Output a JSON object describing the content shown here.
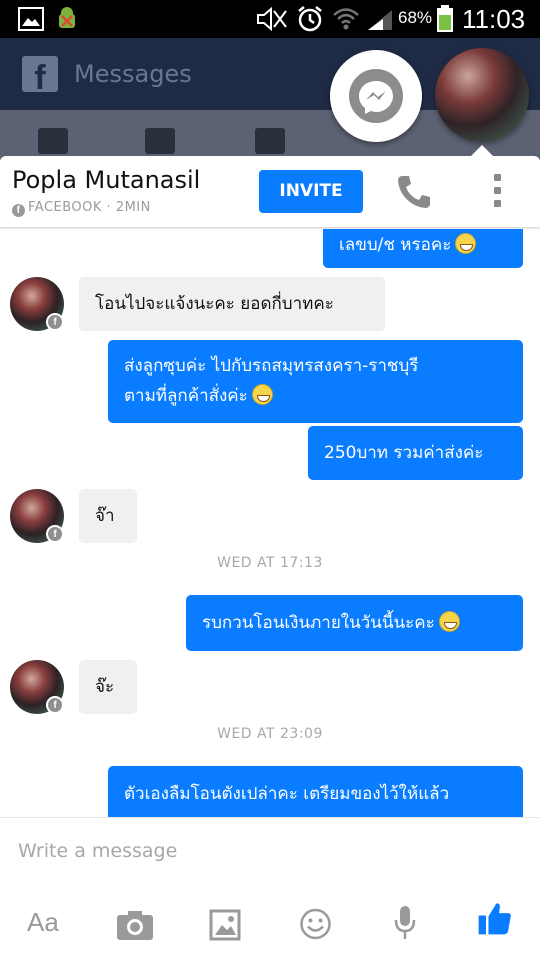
{
  "status_bar": {
    "battery_percent": "68%",
    "time": "11:03",
    "icons": [
      "gallery-icon",
      "android-debug-icon",
      "mute-icon",
      "alarm-icon",
      "wifi-icon",
      "signal-icon",
      "battery-icon"
    ]
  },
  "background_app": {
    "title": "Messages",
    "logo": "f"
  },
  "chat": {
    "contact_name": "Popla Mutanasil",
    "source": "FACEBOOK · 2MIN",
    "invite_label": "INVITE",
    "messages": [
      {
        "dir": "out",
        "text": "เลขบ/ช หรอคะ",
        "emoji": true
      },
      {
        "dir": "in",
        "text": "โอนไปจะแจ้งนะคะ ยอดกี่บาทคะ"
      },
      {
        "dir": "out",
        "line1": "ส่งลูกซุบค่ะ ไปกับรถสมุทรสงครา-ราชบุรี",
        "line2": "ตามที่ลูกค้าสั่งค่ะ",
        "emoji": true
      },
      {
        "dir": "out",
        "text": "250บาท รวมค่าส่งค่ะ"
      },
      {
        "dir": "in",
        "text": "จ๊า"
      },
      {
        "dir": "out",
        "text": "รบกวนโอนเงินภายในวันนี้นะคะ",
        "emoji": true
      },
      {
        "dir": "in",
        "text": "จ๊ะ"
      },
      {
        "dir": "out",
        "text": "ตัวเองลืมโอนตังเปล่าคะ เตรียมของไว้ให้แล้ว"
      }
    ],
    "timestamps": [
      "WED AT 17:13",
      "WED AT 23:09"
    ]
  },
  "composer": {
    "placeholder": "Write a message",
    "aa_label": "Aa"
  },
  "colors": {
    "accent": "#0a7cff",
    "incoming_bubble": "#f1f0f0",
    "like": "#0a7cff"
  }
}
